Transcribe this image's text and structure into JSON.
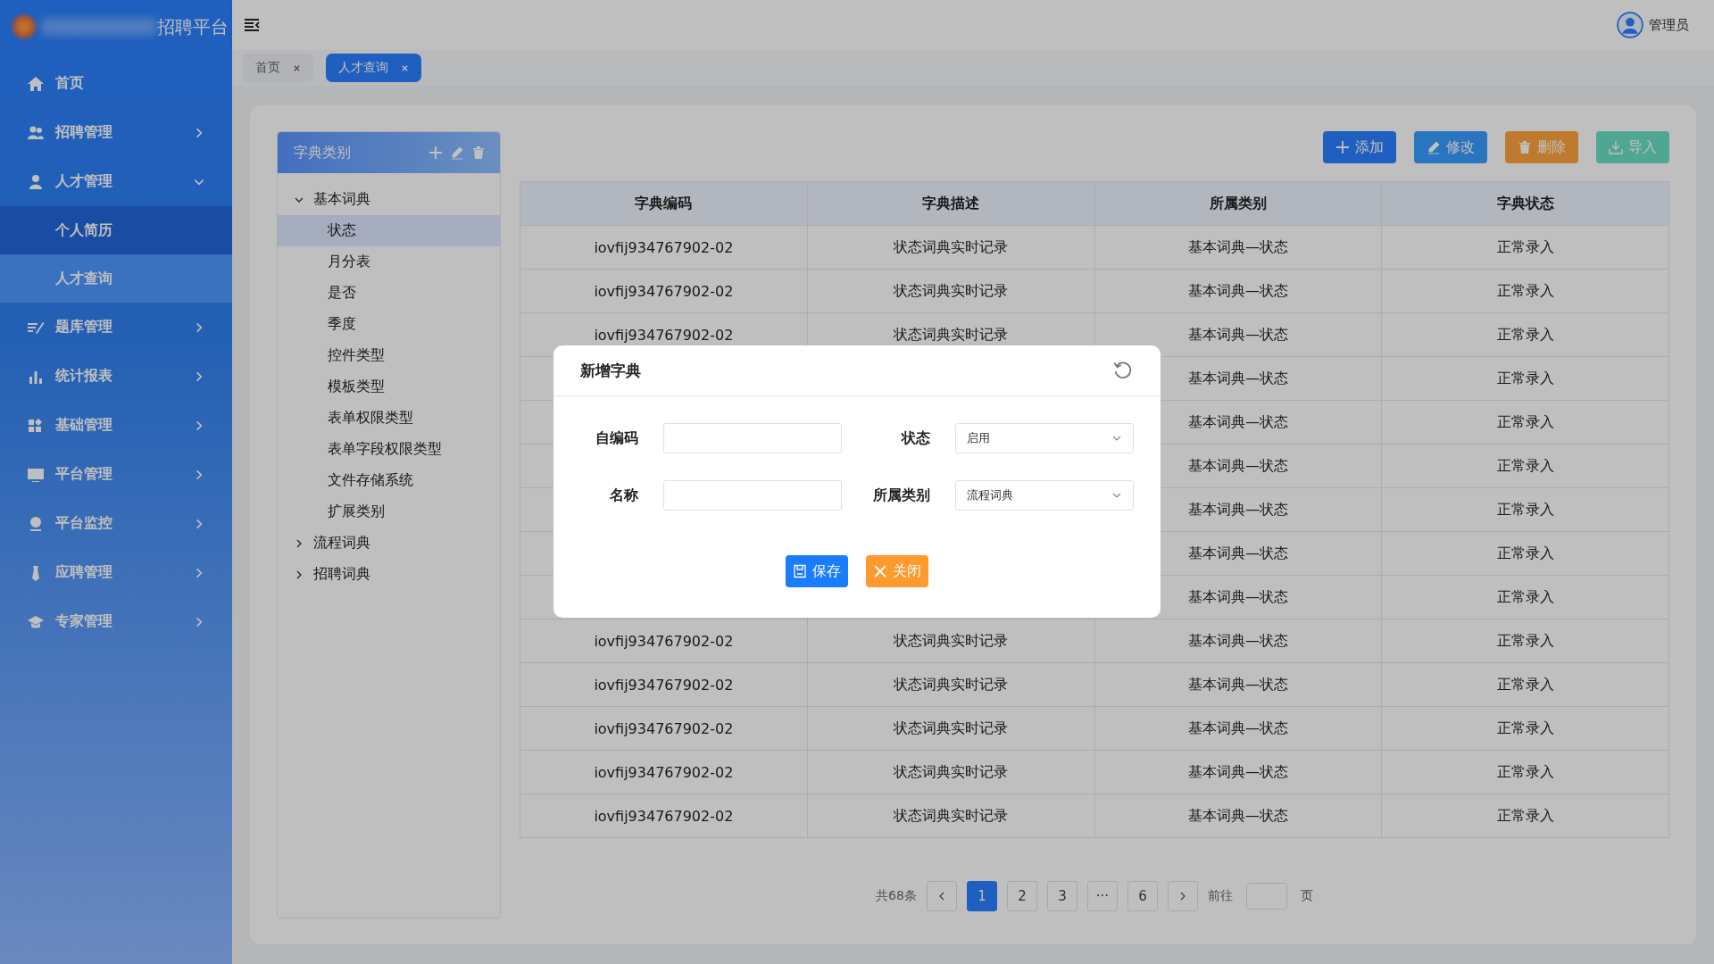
{
  "app": {
    "title": "招聘平台"
  },
  "user": {
    "name": "管理员"
  },
  "sidebar": {
    "items": [
      {
        "label": "首页",
        "kind": "home"
      },
      {
        "label": "招聘管理",
        "kind": "people",
        "expanded": false
      },
      {
        "label": "人才管理",
        "kind": "person",
        "expanded": true,
        "children": [
          {
            "label": "个人简历",
            "selected": true,
            "hovered": false
          },
          {
            "label": "人才查询",
            "selected": false,
            "hovered": true
          }
        ]
      },
      {
        "label": "题库管理",
        "kind": "list",
        "expanded": false
      },
      {
        "label": "统计报表",
        "kind": "bars",
        "expanded": false
      },
      {
        "label": "基础管理",
        "kind": "grid",
        "expanded": false
      },
      {
        "label": "平台管理",
        "kind": "monitor",
        "expanded": false
      },
      {
        "label": "平台监控",
        "kind": "camera",
        "expanded": false
      },
      {
        "label": "应聘管理",
        "kind": "tie",
        "expanded": false
      },
      {
        "label": "专家管理",
        "kind": "cap",
        "expanded": false
      }
    ]
  },
  "tabs": [
    {
      "label": "首页",
      "selected": false
    },
    {
      "label": "人才查询",
      "selected": true
    }
  ],
  "tree": {
    "title": "字典类别",
    "items": [
      {
        "label": "基本词典",
        "expanded": true,
        "children": [
          {
            "label": "状态",
            "selected": true
          },
          {
            "label": "月分表",
            "selected": false
          },
          {
            "label": "是否",
            "selected": false
          },
          {
            "label": "季度",
            "selected": false
          },
          {
            "label": "控件类型",
            "selected": false
          },
          {
            "label": "模板类型",
            "selected": false
          },
          {
            "label": "表单权限类型",
            "selected": false
          },
          {
            "label": "表单字段权限类型",
            "selected": false
          },
          {
            "label": "文件存储系统",
            "selected": false
          },
          {
            "label": "扩展类别",
            "selected": false
          }
        ]
      },
      {
        "label": "流程词典",
        "expanded": false
      },
      {
        "label": "招聘词典",
        "expanded": false
      }
    ]
  },
  "toolbar": [
    {
      "label": "添加",
      "kind": "add"
    },
    {
      "label": "修改",
      "kind": "edit"
    },
    {
      "label": "删除",
      "kind": "delete"
    },
    {
      "label": "导入",
      "kind": "import"
    }
  ],
  "table": {
    "columns": [
      "字典编码",
      "字典描述",
      "所属类别",
      "字典状态"
    ],
    "rows": [
      {
        "code": "iovfij934767902-02",
        "desc": "状态词典实时记录",
        "category": "基本词典—状态",
        "status": "正常录入"
      },
      {
        "code": "iovfij934767902-02",
        "desc": "状态词典实时记录",
        "category": "基本词典—状态",
        "status": "正常录入"
      },
      {
        "code": "iovfij934767902-02",
        "desc": "状态词典实时记录",
        "category": "基本词典—状态",
        "status": "正常录入"
      },
      {
        "category": "基本词典—状态",
        "status": "正常录入"
      },
      {
        "category": "基本词典—状态",
        "status": "正常录入"
      },
      {
        "category": "基本词典—状态",
        "status": "正常录入"
      },
      {
        "category": "基本词典—状态",
        "status": "正常录入"
      },
      {
        "category": "基本词典—状态",
        "status": "正常录入"
      },
      {
        "category": "基本词典—状态",
        "status": "正常录入"
      },
      {
        "code": "iovfij934767902-02",
        "desc": "状态词典实时记录",
        "category": "基本词典—状态",
        "status": "正常录入"
      },
      {
        "code": "iovfij934767902-02",
        "desc": "状态词典实时记录",
        "category": "基本词典—状态",
        "status": "正常录入"
      },
      {
        "code": "iovfij934767902-02",
        "desc": "状态词典实时记录",
        "category": "基本词典—状态",
        "status": "正常录入"
      },
      {
        "code": "iovfij934767902-02",
        "desc": "状态词典实时记录",
        "category": "基本词典—状态",
        "status": "正常录入"
      },
      {
        "code": "iovfij934767902-02",
        "desc": "状态词典实时记录",
        "category": "基本词典—状态",
        "status": "正常录入"
      }
    ]
  },
  "pagination": {
    "total": "共68条",
    "pages": [
      {
        "label": "1",
        "selected": true
      },
      {
        "label": "2",
        "selected": false
      },
      {
        "label": "3",
        "selected": false
      },
      {
        "label": "···",
        "selected": false
      },
      {
        "label": "6",
        "selected": false
      }
    ],
    "goto_label": "前往",
    "page_unit": "页"
  },
  "dialog": {
    "title": "新增字典",
    "fields": [
      {
        "label": "自编码",
        "kind": "text"
      },
      {
        "label": "状态",
        "kind": "select",
        "value": "启用"
      },
      {
        "label": "名称",
        "kind": "text"
      },
      {
        "label": "所属类别",
        "kind": "select",
        "value": "流程词典"
      }
    ],
    "buttons": [
      {
        "label": "保存",
        "kind": "save"
      },
      {
        "label": "关闭",
        "kind": "close"
      }
    ]
  }
}
